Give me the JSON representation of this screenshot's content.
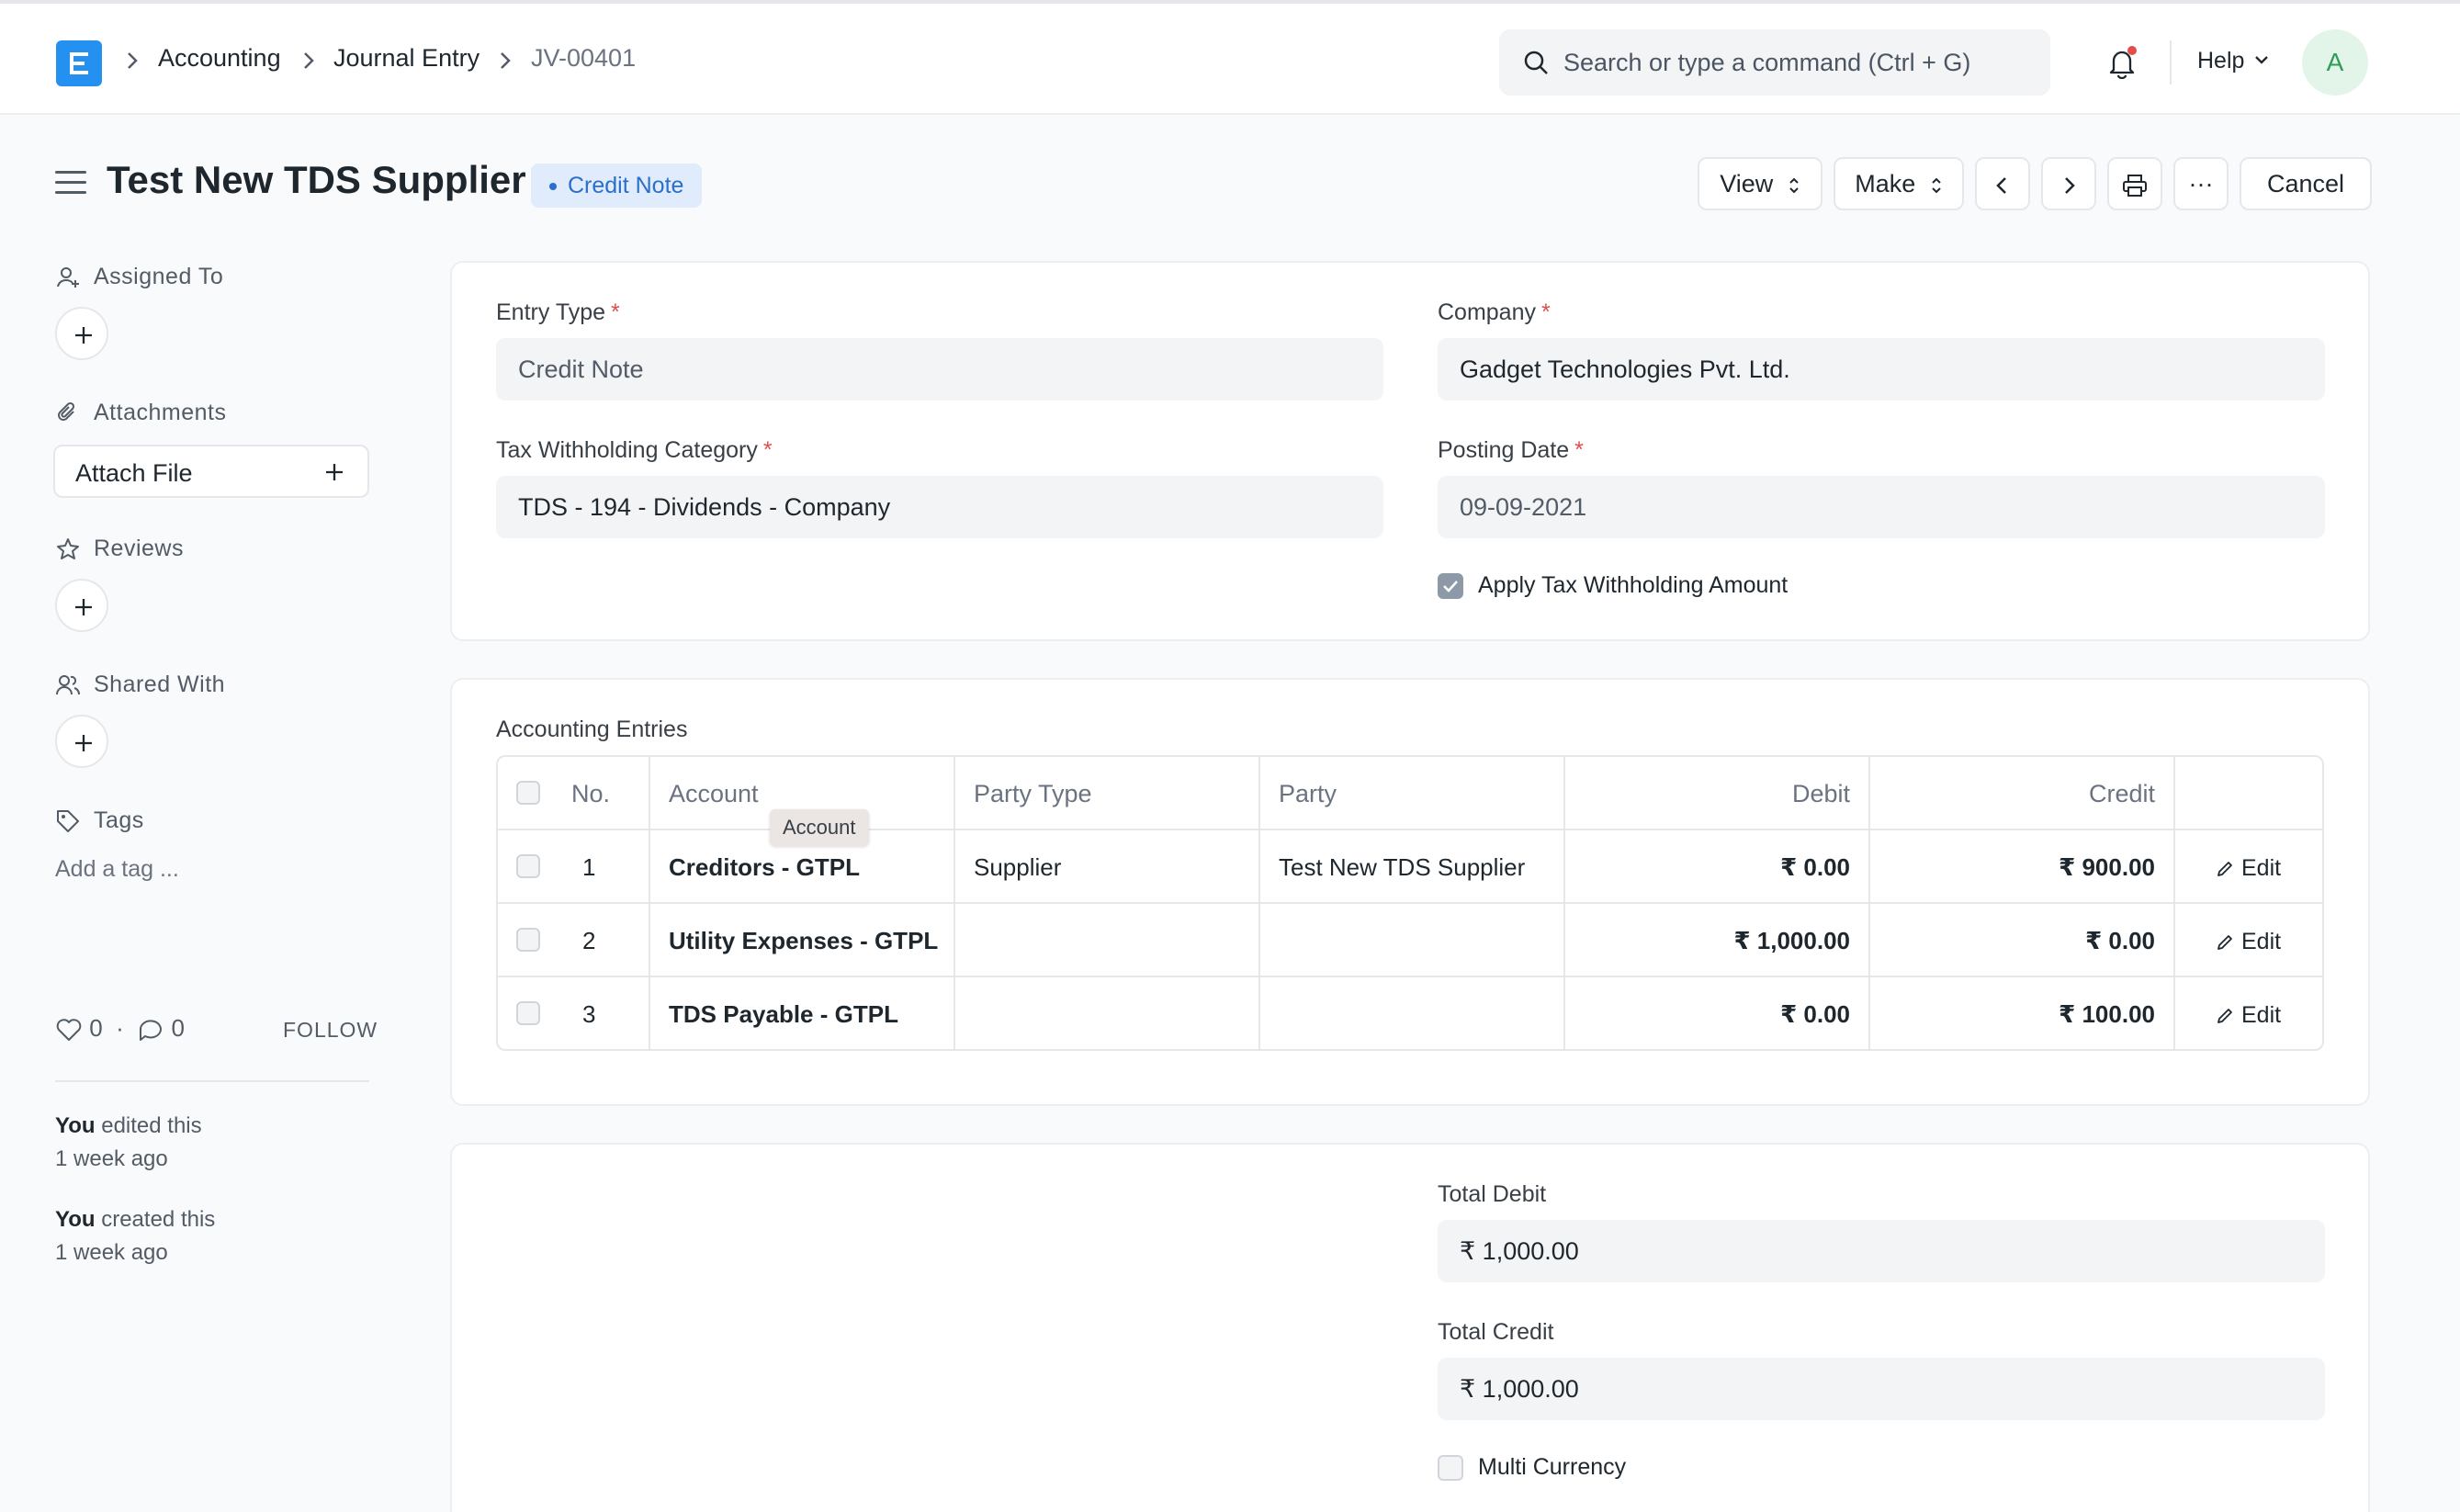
{
  "breadcrumbs": [
    "Accounting",
    "Journal Entry",
    "JV-00401"
  ],
  "search": {
    "placeholder": "Search or type a command (Ctrl + G)"
  },
  "nav": {
    "help_label": "Help",
    "avatar_initial": "A"
  },
  "page": {
    "title": "Test New TDS Supplier",
    "status": "Credit Note",
    "buttons": {
      "view": "View",
      "make": "Make",
      "cancel": "Cancel",
      "more": "···"
    }
  },
  "sidebar": {
    "assigned_to": "Assigned To",
    "attachments": "Attachments",
    "attach_file": "Attach File",
    "reviews": "Reviews",
    "shared_with": "Shared With",
    "tags": "Tags",
    "add_tag": "Add a tag ...",
    "likes": "0",
    "comments": "0",
    "follow": "FOLLOW",
    "timeline": [
      {
        "who": "You",
        "action": "edited this",
        "when": "1 week ago"
      },
      {
        "who": "You",
        "action": "created this",
        "when": "1 week ago"
      }
    ]
  },
  "form": {
    "entry_type": {
      "label": "Entry Type",
      "value": "Credit Note"
    },
    "company": {
      "label": "Company",
      "value": "Gadget Technologies Pvt. Ltd."
    },
    "tax_category": {
      "label": "Tax Withholding Category",
      "value": "TDS - 194 - Dividends - Company"
    },
    "posting_date": {
      "label": "Posting Date",
      "value": "09-09-2021"
    },
    "apply_tax": {
      "label": "Apply Tax Withholding Amount",
      "checked": true
    }
  },
  "entries": {
    "title": "Accounting Entries",
    "columns": {
      "no": "No.",
      "account": "Account",
      "party_type": "Party Type",
      "party": "Party",
      "debit": "Debit",
      "credit": "Credit"
    },
    "tooltip": "Account",
    "edit_label": "Edit",
    "rows": [
      {
        "no": "1",
        "account": "Creditors - GTPL",
        "party_type": "Supplier",
        "party": "Test New TDS Supplier",
        "debit": "₹ 0.00",
        "credit": "₹ 900.00"
      },
      {
        "no": "2",
        "account": "Utility Expenses - GTPL",
        "party_type": "",
        "party": "",
        "debit": "₹ 1,000.00",
        "credit": "₹ 0.00"
      },
      {
        "no": "3",
        "account": "TDS Payable - GTPL",
        "party_type": "",
        "party": "",
        "debit": "₹ 0.00",
        "credit": "₹ 100.00"
      }
    ]
  },
  "totals": {
    "total_debit": {
      "label": "Total Debit",
      "value": "₹ 1,000.00"
    },
    "total_credit": {
      "label": "Total Credit",
      "value": "₹ 1,000.00"
    },
    "multi_currency": {
      "label": "Multi Currency",
      "checked": false
    }
  },
  "colors": {
    "brand": "#2490ef",
    "status_bg": "#e0ecfb",
    "status_text": "#2a6fc9",
    "required": "#e24c4c"
  }
}
